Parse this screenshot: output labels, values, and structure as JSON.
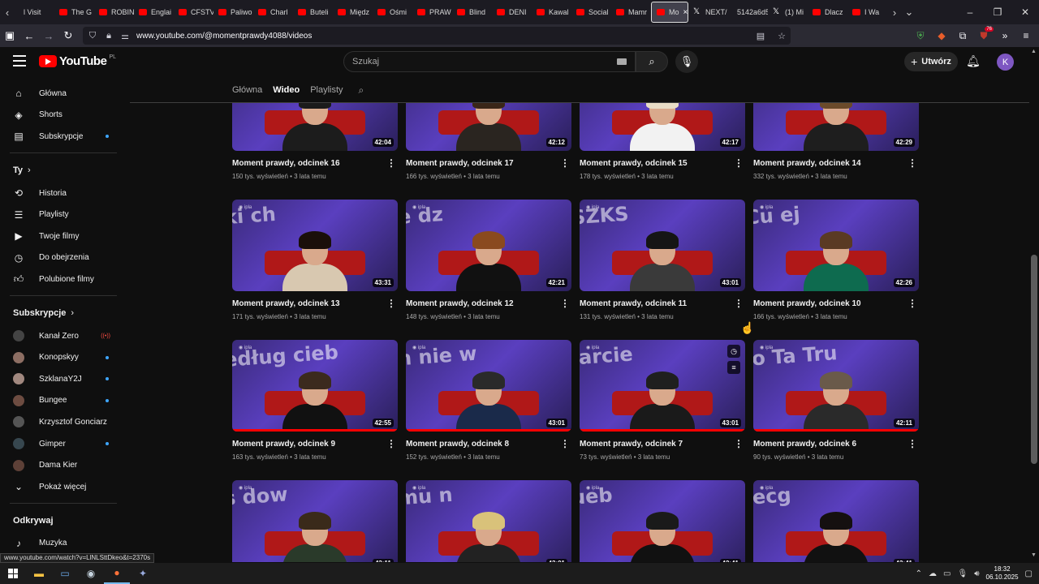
{
  "browser": {
    "tabs": [
      {
        "label": "l Visit",
        "favicon": "none"
      },
      {
        "label": "The G",
        "favicon": "youtube"
      },
      {
        "label": "ROBIN",
        "favicon": "youtube"
      },
      {
        "label": "Englai",
        "favicon": "youtube"
      },
      {
        "label": "CFSTV",
        "favicon": "youtube"
      },
      {
        "label": "Paliwo",
        "favicon": "youtube"
      },
      {
        "label": "Charl",
        "favicon": "youtube"
      },
      {
        "label": "Buteli",
        "favicon": "youtube"
      },
      {
        "label": "Międz",
        "favicon": "youtube"
      },
      {
        "label": "Ośmi",
        "favicon": "youtube"
      },
      {
        "label": "PRAW",
        "favicon": "youtube"
      },
      {
        "label": "Blind",
        "favicon": "youtube"
      },
      {
        "label": "DENI",
        "favicon": "youtube"
      },
      {
        "label": "Kawal",
        "favicon": "youtube"
      },
      {
        "label": "Social",
        "favicon": "youtube"
      },
      {
        "label": "Mamr",
        "favicon": "youtube"
      }
    ],
    "active_tab": "Mo",
    "tabs_after": [
      {
        "label": "NEXT/",
        "favicon": "x"
      },
      {
        "label": "5142a6d5",
        "favicon": "none"
      },
      {
        "label": "(1) Mi",
        "favicon": "x"
      },
      {
        "label": "Dlacz",
        "favicon": "youtube"
      },
      {
        "label": "I Wa",
        "favicon": "youtube"
      }
    ],
    "url": "www.youtube.com/@momentprawdy4088/videos",
    "extension_badge": "76",
    "status_url": "www.youtube.com/watch?v=LlNLSttDkeo&t=2370s"
  },
  "youtube": {
    "logo_text": "YouTube",
    "country_code": "PL",
    "search_placeholder": "Szukaj",
    "create_label": "Utwórz",
    "avatar_letter": "K"
  },
  "sidebar": {
    "main": [
      {
        "label": "Główna",
        "icon": "home-icon"
      },
      {
        "label": "Shorts",
        "icon": "shorts-icon"
      },
      {
        "label": "Subskrypcje",
        "icon": "subscriptions-icon",
        "dot": true
      }
    ],
    "you_header": "Ty",
    "you": [
      {
        "label": "Historia",
        "icon": "history-icon"
      },
      {
        "label": "Playlisty",
        "icon": "playlists-icon"
      },
      {
        "label": "Twoje filmy",
        "icon": "your-videos-icon"
      },
      {
        "label": "Do obejrzenia",
        "icon": "watch-later-icon"
      },
      {
        "label": "Polubione filmy",
        "icon": "liked-icon"
      }
    ],
    "subs_header": "Subskrypcje",
    "subs": [
      {
        "label": "Kanał Zero",
        "live": true
      },
      {
        "label": "Konopskyy",
        "dot": true
      },
      {
        "label": "SzklanaY2J",
        "dot": true
      },
      {
        "label": "Bungee",
        "dot": true
      },
      {
        "label": "Krzysztof Gonciarz"
      },
      {
        "label": "Gimper",
        "dot": true
      },
      {
        "label": "Dama Kier"
      }
    ],
    "show_more": "Pokaż więcej",
    "explore_header": "Odkrywaj",
    "explore": [
      {
        "label": "Muzyka",
        "icon": "music-icon"
      }
    ]
  },
  "channel_tabs": [
    "Główna",
    "Wideo",
    "Playlisty"
  ],
  "channel_tab_selected": "Wideo",
  "videos": [
    {
      "title": "Moment prawdy, odcinek 16",
      "duration": "42:04",
      "views": "150 tys. wyświetleń",
      "age": "3 lata temu",
      "progress": 0
    },
    {
      "title": "Moment prawdy, odcinek 17",
      "duration": "42:12",
      "views": "166 tys. wyświetleń",
      "age": "3 lata temu",
      "progress": 0
    },
    {
      "title": "Moment prawdy, odcinek 15",
      "duration": "42:17",
      "views": "178 tys. wyświetleń",
      "age": "3 lata temu",
      "progress": 0
    },
    {
      "title": "Moment prawdy, odcinek 14",
      "duration": "42:29",
      "views": "332 tys. wyświetleń",
      "age": "3 lata temu",
      "progress": 0
    },
    {
      "title": "Moment prawdy, odcinek 13",
      "duration": "43:31",
      "views": "171 tys. wyświetleń",
      "age": "3 lata temu",
      "progress": 0
    },
    {
      "title": "Moment prawdy, odcinek 12",
      "duration": "42:21",
      "views": "148 tys. wyświetleń",
      "age": "3 lata temu",
      "progress": 0
    },
    {
      "title": "Moment prawdy, odcinek 11",
      "duration": "43:01",
      "views": "131 tys. wyświetleń",
      "age": "3 lata temu",
      "progress": 0
    },
    {
      "title": "Moment prawdy, odcinek 10",
      "duration": "42:26",
      "views": "166 tys. wyświetleń",
      "age": "3 lata temu",
      "progress": 0
    },
    {
      "title": "Moment prawdy, odcinek 9",
      "duration": "42:55",
      "views": "163 tys. wyświetleń",
      "age": "3 lata temu",
      "progress": 1.0
    },
    {
      "title": "Moment prawdy, odcinek 8",
      "duration": "43:01",
      "views": "152 tys. wyświetleń",
      "age": "3 lata temu",
      "progress": 1.0
    },
    {
      "title": "Moment prawdy, odcinek 7",
      "duration": "43:01",
      "views": "73 tys. wyświetleń",
      "age": "3 lata temu",
      "progress": 1.0,
      "hover": true
    },
    {
      "title": "Moment prawdy, odcinek 6",
      "duration": "42:11",
      "views": "90 tys. wyświetleń",
      "age": "3 lata temu",
      "progress": 1.0
    },
    {
      "title": "",
      "duration": "43:11",
      "views": "",
      "age": "",
      "progress": 0
    },
    {
      "title": "",
      "duration": "43:01",
      "views": "",
      "age": "",
      "progress": 0
    },
    {
      "title": "",
      "duration": "42:41",
      "views": "",
      "age": "",
      "progress": 0
    },
    {
      "title": "",
      "duration": "43:41",
      "views": "",
      "age": "",
      "progress": 0
    }
  ],
  "taskbar": {
    "time": "18:32",
    "date": "06.10.2025"
  },
  "colors": {
    "accent_red": "#ff0000",
    "avatar": "#7e57c2",
    "dot_blue": "#3ea6ff"
  }
}
